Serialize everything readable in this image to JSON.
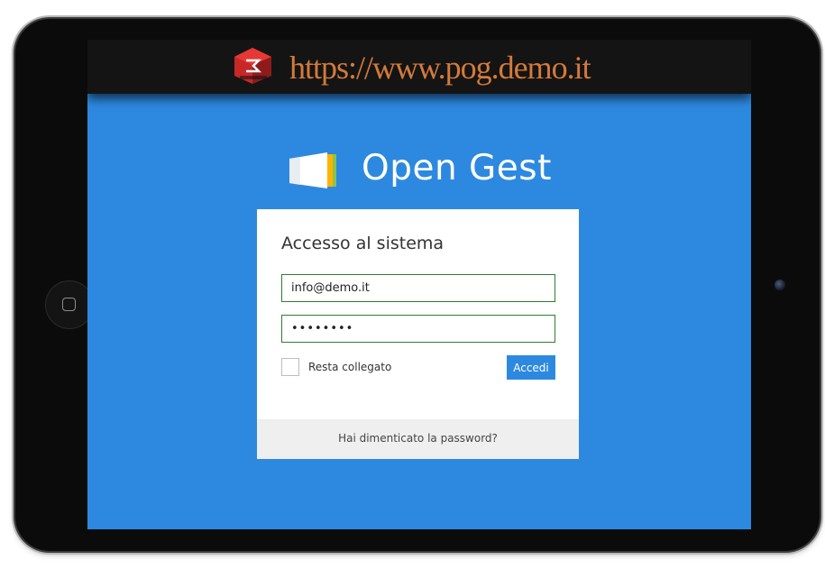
{
  "url_bar": {
    "url": "https://www.pog.demo.it",
    "logo_icon": "site-logo-icon"
  },
  "app": {
    "name": "Open Gest",
    "logo_icon": "open-gest-logo-icon"
  },
  "login": {
    "title": "Accesso al sistema",
    "email_value": "info@demo.it",
    "password_value": "pogdemo1",
    "remember_label": "Resta collegato",
    "remember_checked": false,
    "submit_label": "Accedi",
    "forgot_label": "Hai dimenticato la password?"
  },
  "device": {
    "home_button_icon": "home-button-icon",
    "camera_icon": "camera-icon"
  },
  "colors": {
    "screen_background": "#2d89e0",
    "url_text": "#d47a3b",
    "field_border": "#2e7d32",
    "button_background": "#2d89e0",
    "footer_background": "#efefef"
  }
}
